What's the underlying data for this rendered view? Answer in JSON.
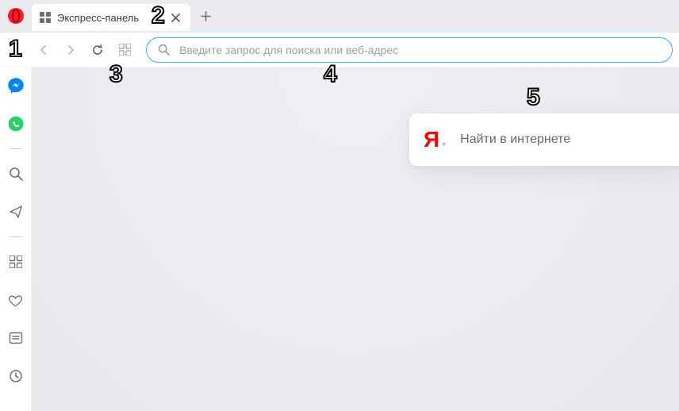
{
  "tab": {
    "title": "Экспресс-панель"
  },
  "address": {
    "placeholder": "Введите запрос для поиска или веб-адрес"
  },
  "content": {
    "search_engine": {
      "logo_letter": "Я",
      "placeholder": "Найти в интернете"
    }
  },
  "annotations": {
    "n1": "1",
    "n2": "2",
    "n3": "3",
    "n4": "4",
    "n5": "5"
  }
}
